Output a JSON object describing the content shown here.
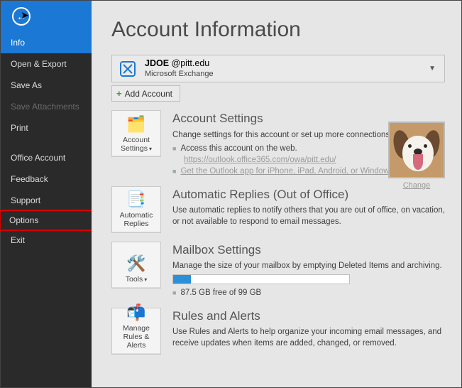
{
  "sidebar": {
    "items": [
      {
        "label": "Info",
        "state": "active"
      },
      {
        "label": "Open & Export",
        "state": "normal"
      },
      {
        "label": "Save As",
        "state": "normal"
      },
      {
        "label": "Save Attachments",
        "state": "disabled"
      },
      {
        "label": "Print",
        "state": "normal"
      },
      {
        "label": "Office Account",
        "state": "normal"
      },
      {
        "label": "Feedback",
        "state": "normal"
      },
      {
        "label": "Support",
        "state": "normal"
      },
      {
        "label": "Options",
        "state": "highlight"
      },
      {
        "label": "Exit",
        "state": "normal"
      }
    ]
  },
  "page": {
    "title": "Account Information"
  },
  "account": {
    "email_user": "JDOE",
    "email_domain": "@pitt.edu",
    "type": "Microsoft Exchange",
    "add_label": "Add Account"
  },
  "settings": {
    "tile": "Account Settings",
    "title": "Account Settings",
    "sub": "Change settings for this account or set up more connections.",
    "line1": "Access this account on the web.",
    "url": "https://outlook.office365.com/owa/pitt.edu/",
    "line2": "Get the Outlook app for iPhone, iPad, Android, or Windows 10 Mobile."
  },
  "avatar": {
    "change": "Change"
  },
  "auto": {
    "tile": "Automatic Replies",
    "title": "Automatic Replies (Out of Office)",
    "sub": "Use automatic replies to notify others that you are out of office, on vacation, or not available to respond to email messages."
  },
  "mailbox": {
    "tile": "Tools",
    "title": "Mailbox Settings",
    "sub": "Manage the size of your mailbox by emptying Deleted Items and archiving.",
    "usage": "87.5 GB free of 99 GB"
  },
  "rules": {
    "tile": "Manage Rules & Alerts",
    "title": "Rules and Alerts",
    "sub": "Use Rules and Alerts to help organize your incoming email messages, and receive updates when items are added, changed, or removed."
  }
}
